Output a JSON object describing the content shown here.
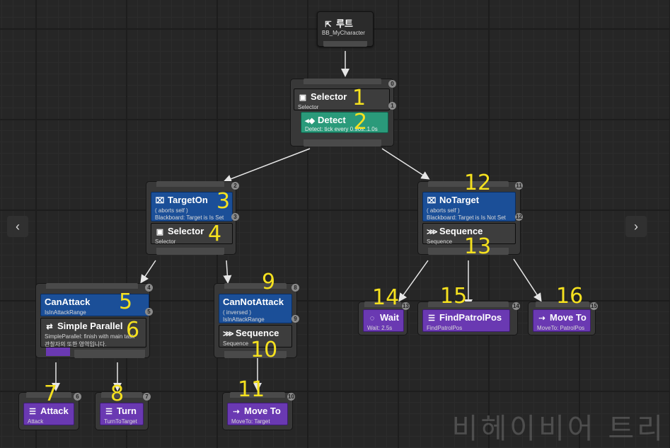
{
  "root": {
    "title": "루트",
    "subtitle": "BB_MyCharacter",
    "icon": "root-tree-icon"
  },
  "nodes": {
    "selector_root": {
      "title": "Selector",
      "subtitle": "Selector",
      "index": "0",
      "index2": "1"
    },
    "detect": {
      "title": "Detect",
      "subtitle": "Detect: tick every 0.90s..1.0s"
    },
    "target_on": {
      "title": "TargetOn",
      "line1": "( aborts self )",
      "line2": "Blackboard: Target is Is Set",
      "index": "2",
      "index2": "3"
    },
    "selector_left": {
      "title": "Selector",
      "subtitle": "Selector"
    },
    "no_target": {
      "title": "NoTarget",
      "line1": "( aborts self )",
      "line2": "Blackboard: Target is Is Not Set",
      "index": "11",
      "index2": "12"
    },
    "sequence_right": {
      "title": "Sequence",
      "subtitle": "Sequence"
    },
    "can_attack": {
      "title": "CanAttack",
      "line1": "IsInAttackRange",
      "index": "4",
      "index2": "5"
    },
    "simple_parallel": {
      "title": "Simple Parallel",
      "line1": "SimpleParallel: finish with main task",
      "line2": "관찰자의 또한 영역입니다."
    },
    "can_not_attack": {
      "title": "CanNotAttack",
      "line1": "( inversed )",
      "line2": "IsInAttackRange",
      "index": "8",
      "index2": "9"
    },
    "sequence_mid": {
      "title": "Sequence",
      "subtitle": "Sequence"
    },
    "wait": {
      "title": "Wait",
      "subtitle": "Wait: 2.5s",
      "index": "13"
    },
    "find_patrol": {
      "title": "FindPatrolPos",
      "subtitle": "FindPatrolPos",
      "index": "14"
    },
    "move_to_patrol": {
      "title": "Move To",
      "subtitle": "MoveTo: PatrolPos",
      "index": "15"
    },
    "attack": {
      "title": "Attack",
      "subtitle": "Attack",
      "index": "6"
    },
    "turn": {
      "title": "Turn",
      "subtitle": "TurnToTarget",
      "index": "7"
    },
    "move_to_target": {
      "title": "Move To",
      "subtitle": "MoveTo: Target",
      "index": "10"
    }
  },
  "annotations": [
    "1",
    "2",
    "3",
    "4",
    "5",
    "6",
    "7",
    "8",
    "9",
    "10",
    "11",
    "12",
    "13",
    "14",
    "15",
    "16"
  ],
  "nav": {
    "prev": "‹",
    "next": "›"
  },
  "watermark": "비헤이비어 트리"
}
